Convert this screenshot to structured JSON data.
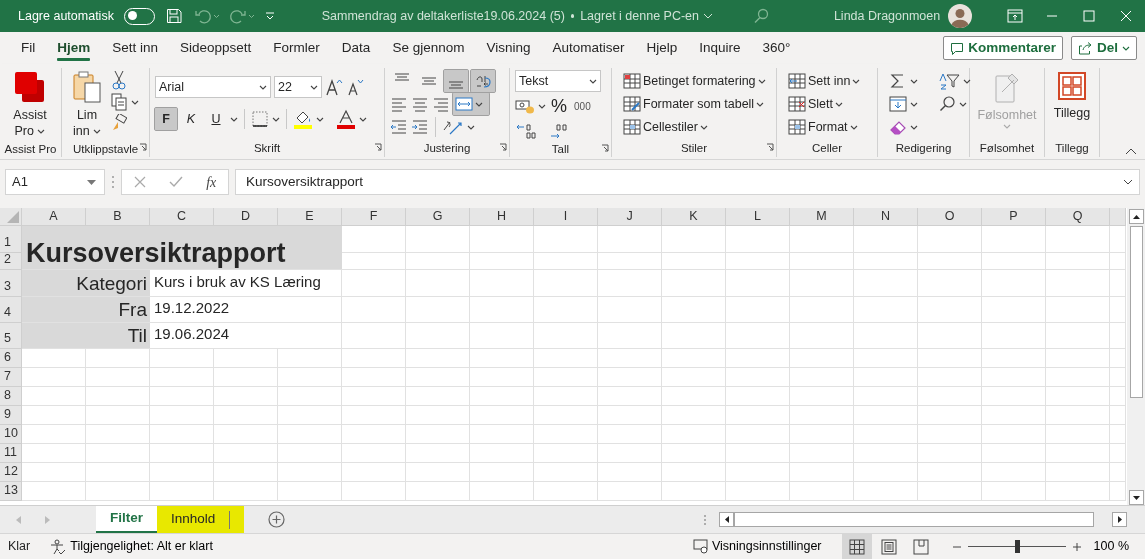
{
  "title_bar": {
    "autosave_label": "Lagre automatisk",
    "autosave_on": false,
    "document_title": "Sammendrag av deltakerliste19.06.2024 (5)",
    "save_status": "Lagret i denne PC-en",
    "user_name": "Linda Dragonmoen"
  },
  "ribbon_tabs": [
    {
      "label": "Fil",
      "selected": false
    },
    {
      "label": "Hjem",
      "selected": true
    },
    {
      "label": "Sett inn",
      "selected": false
    },
    {
      "label": "Sideoppsett",
      "selected": false
    },
    {
      "label": "Formler",
      "selected": false
    },
    {
      "label": "Data",
      "selected": false
    },
    {
      "label": "Se gjennom",
      "selected": false
    },
    {
      "label": "Visning",
      "selected": false
    },
    {
      "label": "Automatiser",
      "selected": false
    },
    {
      "label": "Hjelp",
      "selected": false
    },
    {
      "label": "Inquire",
      "selected": false
    },
    {
      "label": "360°",
      "selected": false
    }
  ],
  "ribbon_actions": [
    {
      "kind": "comments",
      "label": "Kommentarer"
    },
    {
      "kind": "share",
      "label": "Del"
    }
  ],
  "ribbon_groups": [
    {
      "kind": "assist",
      "label": "Assist Pro",
      "button": "Assist Pro"
    },
    {
      "kind": "clipboard",
      "label": "Utklippstavle",
      "button": "Lim inn"
    },
    {
      "kind": "font",
      "label": "Skrift",
      "font": "Arial",
      "size": "22",
      "style_buttons": [
        {
          "label": "F",
          "on": true
        },
        {
          "label": "K",
          "on": false
        },
        {
          "label": "U",
          "on": false
        }
      ]
    },
    {
      "kind": "alignment",
      "label": "Justering",
      "toggles": [
        {
          "kind": "align-top",
          "on": false
        },
        {
          "kind": "align-middle",
          "on": false
        },
        {
          "kind": "align-bottom",
          "on": true
        },
        {
          "kind": "wrap",
          "on": true
        }
      ],
      "merge_on": true
    },
    {
      "kind": "number",
      "label": "Tall",
      "format": "Tekst",
      "symbols": [
        "%",
        "000"
      ]
    },
    {
      "kind": "styles",
      "label": "Stiler",
      "commands": [
        "Betinget formatering",
        "Formater som tabell",
        "Cellestiler"
      ]
    },
    {
      "kind": "cells",
      "label": "Celler",
      "commands": [
        "Sett inn",
        "Slett",
        "Format"
      ]
    },
    {
      "kind": "editing",
      "label": "Redigering"
    },
    {
      "kind": "sensitivity",
      "label": "Følsomhet",
      "button": "Følsomhet",
      "disabled": true
    },
    {
      "kind": "addins",
      "label": "Tillegg",
      "button": "Tillegg"
    }
  ],
  "formula_bar": {
    "name_box": "A1",
    "fx": "fx",
    "formula": "Kursoversiktrapport"
  },
  "sheet": {
    "columns": [
      "A",
      "B",
      "C",
      "D",
      "E",
      "F",
      "G",
      "H",
      "I",
      "J",
      "K",
      "L",
      "M",
      "N",
      "O",
      "P",
      "Q"
    ],
    "rows": [
      "1",
      "2",
      "3",
      "4",
      "5",
      "6",
      "7",
      "8",
      "9",
      "10",
      "11",
      "12",
      "13"
    ],
    "title": "Kursoversiktrapport",
    "fields": [
      {
        "label": "Kategori",
        "value": "Kurs i bruk av KS Læring"
      },
      {
        "label": "Fra",
        "value": "19.12.2022"
      },
      {
        "label": "Til",
        "value": "19.06.2024"
      }
    ]
  },
  "sheet_tabs": [
    {
      "label": "Filter",
      "selected": true
    },
    {
      "label": "Innhold",
      "selected": false,
      "color": "#e8e800"
    }
  ],
  "status_bar": {
    "ready": "Klar",
    "accessibility": "Tilgjengelighet: Alt er klart",
    "view_settings": "Visningsinnstillinger",
    "views": [
      {
        "kind": "normal",
        "selected": true
      },
      {
        "kind": "page-layout",
        "selected": false
      },
      {
        "kind": "page-break",
        "selected": false
      }
    ],
    "zoom": {
      "level": 0.5,
      "reading": "100 %"
    }
  }
}
